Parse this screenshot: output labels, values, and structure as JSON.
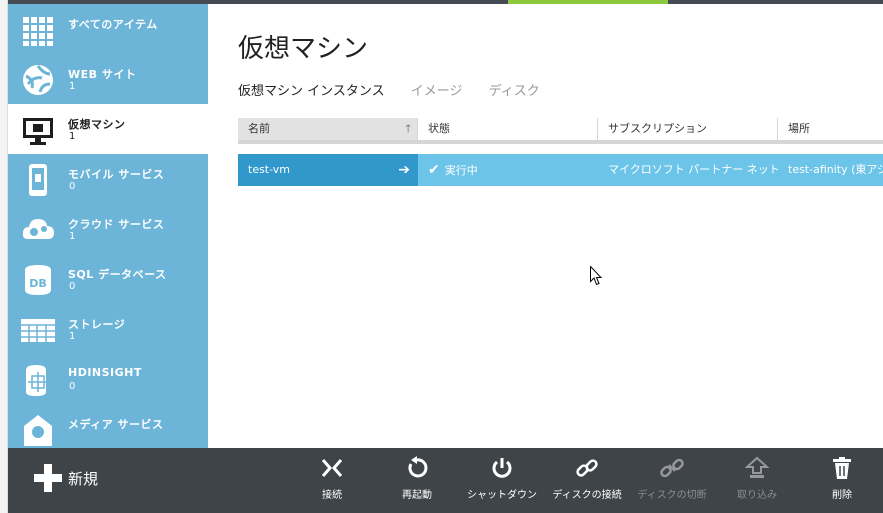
{
  "page": {
    "title": "仮想マシン",
    "subtabs": [
      {
        "label": "仮想マシン インスタンス",
        "active": true
      },
      {
        "label": "イメージ",
        "active": false
      },
      {
        "label": "ディスク",
        "active": false
      }
    ]
  },
  "sidebar": {
    "items": [
      {
        "label": "すべてのアイテム",
        "count": "",
        "icon": "grid-icon"
      },
      {
        "label": "WEB サイト",
        "count": "1",
        "icon": "globe-icon"
      },
      {
        "label": "仮想マシン",
        "count": "1",
        "icon": "monitor-icon",
        "active": true
      },
      {
        "label": "モバイル サービス",
        "count": "0",
        "icon": "mobile-icon"
      },
      {
        "label": "クラウド サービス",
        "count": "1",
        "icon": "cloud-gear-icon"
      },
      {
        "label": "SQL データベース",
        "count": "0",
        "icon": "database-icon"
      },
      {
        "label": "ストレージ",
        "count": "1",
        "icon": "table-icon"
      },
      {
        "label": "HDINSIGHT",
        "count": "0",
        "icon": "hdinsight-icon"
      },
      {
        "label": "メディア サービス",
        "count": "",
        "icon": "media-icon"
      }
    ]
  },
  "table": {
    "columns": [
      "名前",
      "状態",
      "サブスクリプション",
      "場所"
    ],
    "rows": [
      {
        "name": "test-vm",
        "status": "実行中",
        "subscription": "マイクロソフト パートナー ネットワ…",
        "location": "test-afinity (東アジア)"
      }
    ]
  },
  "commandbar": {
    "new_label": "新規",
    "commands": [
      {
        "label": "接続",
        "icon": "connect-icon",
        "enabled": true
      },
      {
        "label": "再起動",
        "icon": "restart-icon",
        "enabled": true
      },
      {
        "label": "シャットダウン",
        "icon": "power-icon",
        "enabled": true
      },
      {
        "label": "ディスクの接続",
        "icon": "link-icon",
        "enabled": true
      },
      {
        "label": "ディスクの切断",
        "icon": "unlink-icon",
        "enabled": false
      },
      {
        "label": "取り込み",
        "icon": "capture-icon",
        "enabled": false
      },
      {
        "label": "削除",
        "icon": "trash-icon",
        "enabled": true
      }
    ]
  },
  "colors": {
    "sidebar": "#6cb4d8",
    "row_selected": "#6cc4e8",
    "row_name_cell": "#3198cc",
    "commandbar": "#3f4449",
    "accent_green": "#8cc83c"
  }
}
